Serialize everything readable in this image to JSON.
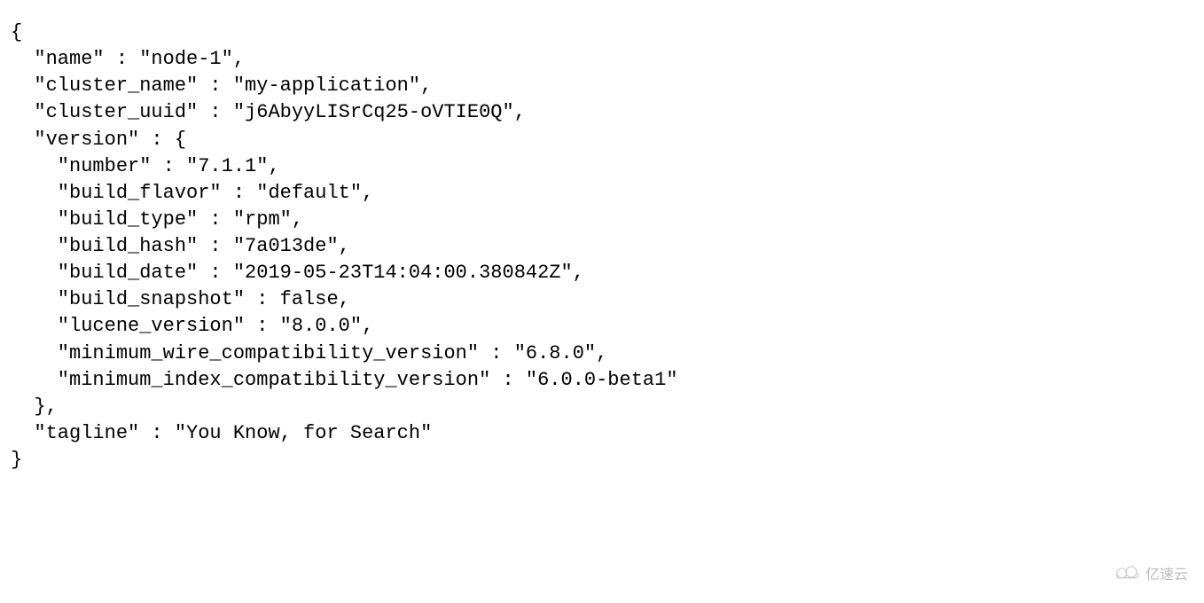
{
  "code": {
    "line1": "{",
    "line2": "  \"name\" : \"node-1\",",
    "line3": "  \"cluster_name\" : \"my-application\",",
    "line4": "  \"cluster_uuid\" : \"j6AbyyLISrCq25-oVTIE0Q\",",
    "line5": "  \"version\" : {",
    "line6": "    \"number\" : \"7.1.1\",",
    "line7": "    \"build_flavor\" : \"default\",",
    "line8": "    \"build_type\" : \"rpm\",",
    "line9": "    \"build_hash\" : \"7a013de\",",
    "line10": "    \"build_date\" : \"2019-05-23T14:04:00.380842Z\",",
    "line11": "    \"build_snapshot\" : false,",
    "line12": "    \"lucene_version\" : \"8.0.0\",",
    "line13": "    \"minimum_wire_compatibility_version\" : \"6.8.0\",",
    "line14": "    \"minimum_index_compatibility_version\" : \"6.0.0-beta1\"",
    "line15": "  },",
    "line16": "  \"tagline\" : \"You Know, for Search\"",
    "line17": "}"
  },
  "watermark": {
    "text": "亿速云"
  }
}
